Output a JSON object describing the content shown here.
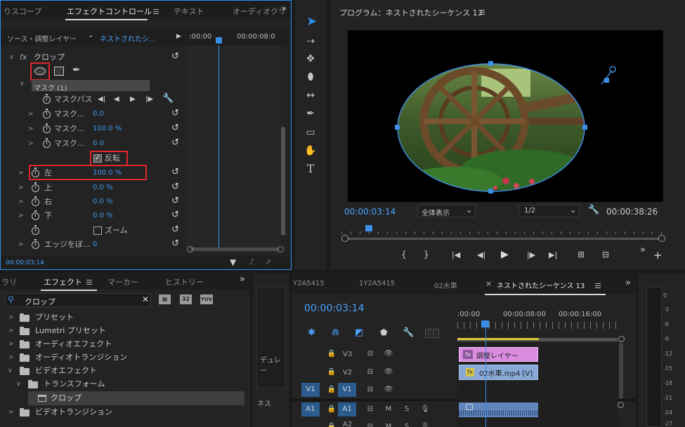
{
  "effect_controls": {
    "tabs": [
      "りスコープ",
      "エフェクトコントロール",
      "テキスト",
      "オーディオクリ"
    ],
    "source_label": "ソース・調整レイヤー",
    "sequence_label": "ネストされたシ...",
    "time_start": ":00:00",
    "time_end": "00:00:08:0",
    "effect_name": "クロップ",
    "fx_label": "fx",
    "mask_label": "マスク (1)",
    "mask_path_label": "マスクパス",
    "mask_rows": [
      {
        "label": "マスク...",
        "value": "0.0"
      },
      {
        "label": "マスク...",
        "value": "100.0 %"
      },
      {
        "label": "マスク...",
        "value": "0.0"
      }
    ],
    "invert_label": "反転",
    "crop_rows": [
      {
        "label": "左",
        "value": "100.0 %"
      },
      {
        "label": "上",
        "value": "0.0 %"
      },
      {
        "label": "右",
        "value": "0.0 %"
      },
      {
        "label": "下",
        "value": "0.0 %"
      }
    ],
    "zoom_label": "ズーム",
    "edge_label": "エッジをぼ...",
    "edge_value": "0",
    "current_time": "00:00:03:14"
  },
  "program_monitor": {
    "title": "プログラム：ネストされたシーケンス 13",
    "timecode": "00:00:03:14",
    "fit_label": "全体表示",
    "quality_label": "1/2",
    "duration": "00:00:38:26"
  },
  "effects_panel": {
    "tabs": [
      "ラリ",
      "エフェクト",
      "マーカー",
      "ヒストリー"
    ],
    "search_value": "クロップ",
    "badges": [
      "32",
      "YUV"
    ],
    "tree": [
      {
        "label": "プリセット",
        "level": 0,
        "open": false
      },
      {
        "label": "Lumetri プリセット",
        "level": 0,
        "open": false
      },
      {
        "label": "オーディオエフェクト",
        "level": 0,
        "open": false
      },
      {
        "label": "オーディオトランジション",
        "level": 0,
        "open": false
      },
      {
        "label": "ビデオエフェクト",
        "level": 0,
        "open": true
      },
      {
        "label": "トランスフォーム",
        "level": 1,
        "open": true
      },
      {
        "label": "クロップ",
        "level": 2,
        "open": false
      },
      {
        "label": "ビデオトランジション",
        "level": 0,
        "open": false
      }
    ]
  },
  "middle_panel": {
    "label1": "デュレー",
    "label2": "ネス"
  },
  "timeline": {
    "tabs": [
      "Y2A5415",
      "1Y2A5415",
      "02水車",
      "ネストされたシーケンス 13"
    ],
    "timecode": "00:00:03:14",
    "ruler": [
      ":00:00",
      "00:00:08:00",
      "00:00:16:00"
    ],
    "tracks": [
      {
        "name": "V3",
        "src": ""
      },
      {
        "name": "V2",
        "src": ""
      },
      {
        "name": "V1",
        "src": "V1"
      },
      {
        "name": "A1",
        "src": "A1"
      },
      {
        "name": "A2",
        "src": ""
      }
    ],
    "clips": {
      "adjustment": "調整レイヤー",
      "video": "02水車.mp4 [V]"
    }
  },
  "audio_meter": {
    "scale": [
      "0",
      "-3",
      "-6",
      "-9",
      "-12",
      "-15",
      "-18",
      "-21",
      "-24",
      "-27"
    ]
  }
}
